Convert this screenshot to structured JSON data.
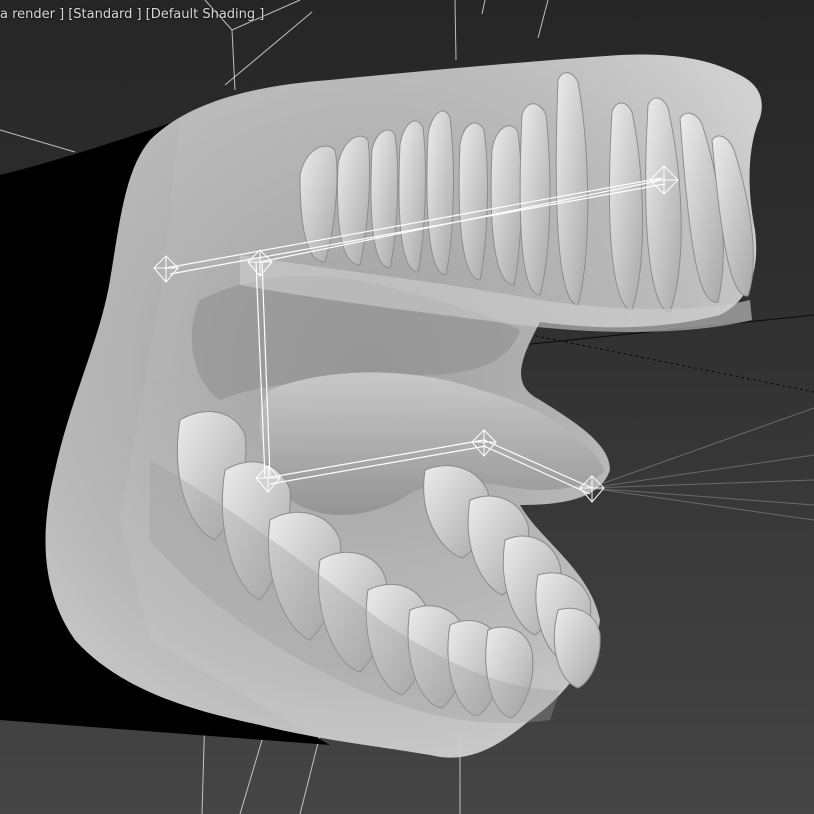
{
  "viewport": {
    "label_segments": [
      "a render ]",
      "[Standard ]",
      "[Default Shading ]"
    ]
  },
  "colors": {
    "background_top": "#262626",
    "background_bottom": "#454545",
    "model_fill": "#bcbcbc",
    "bone_wire": "#ffffff",
    "shadow_mass": "#000000"
  }
}
